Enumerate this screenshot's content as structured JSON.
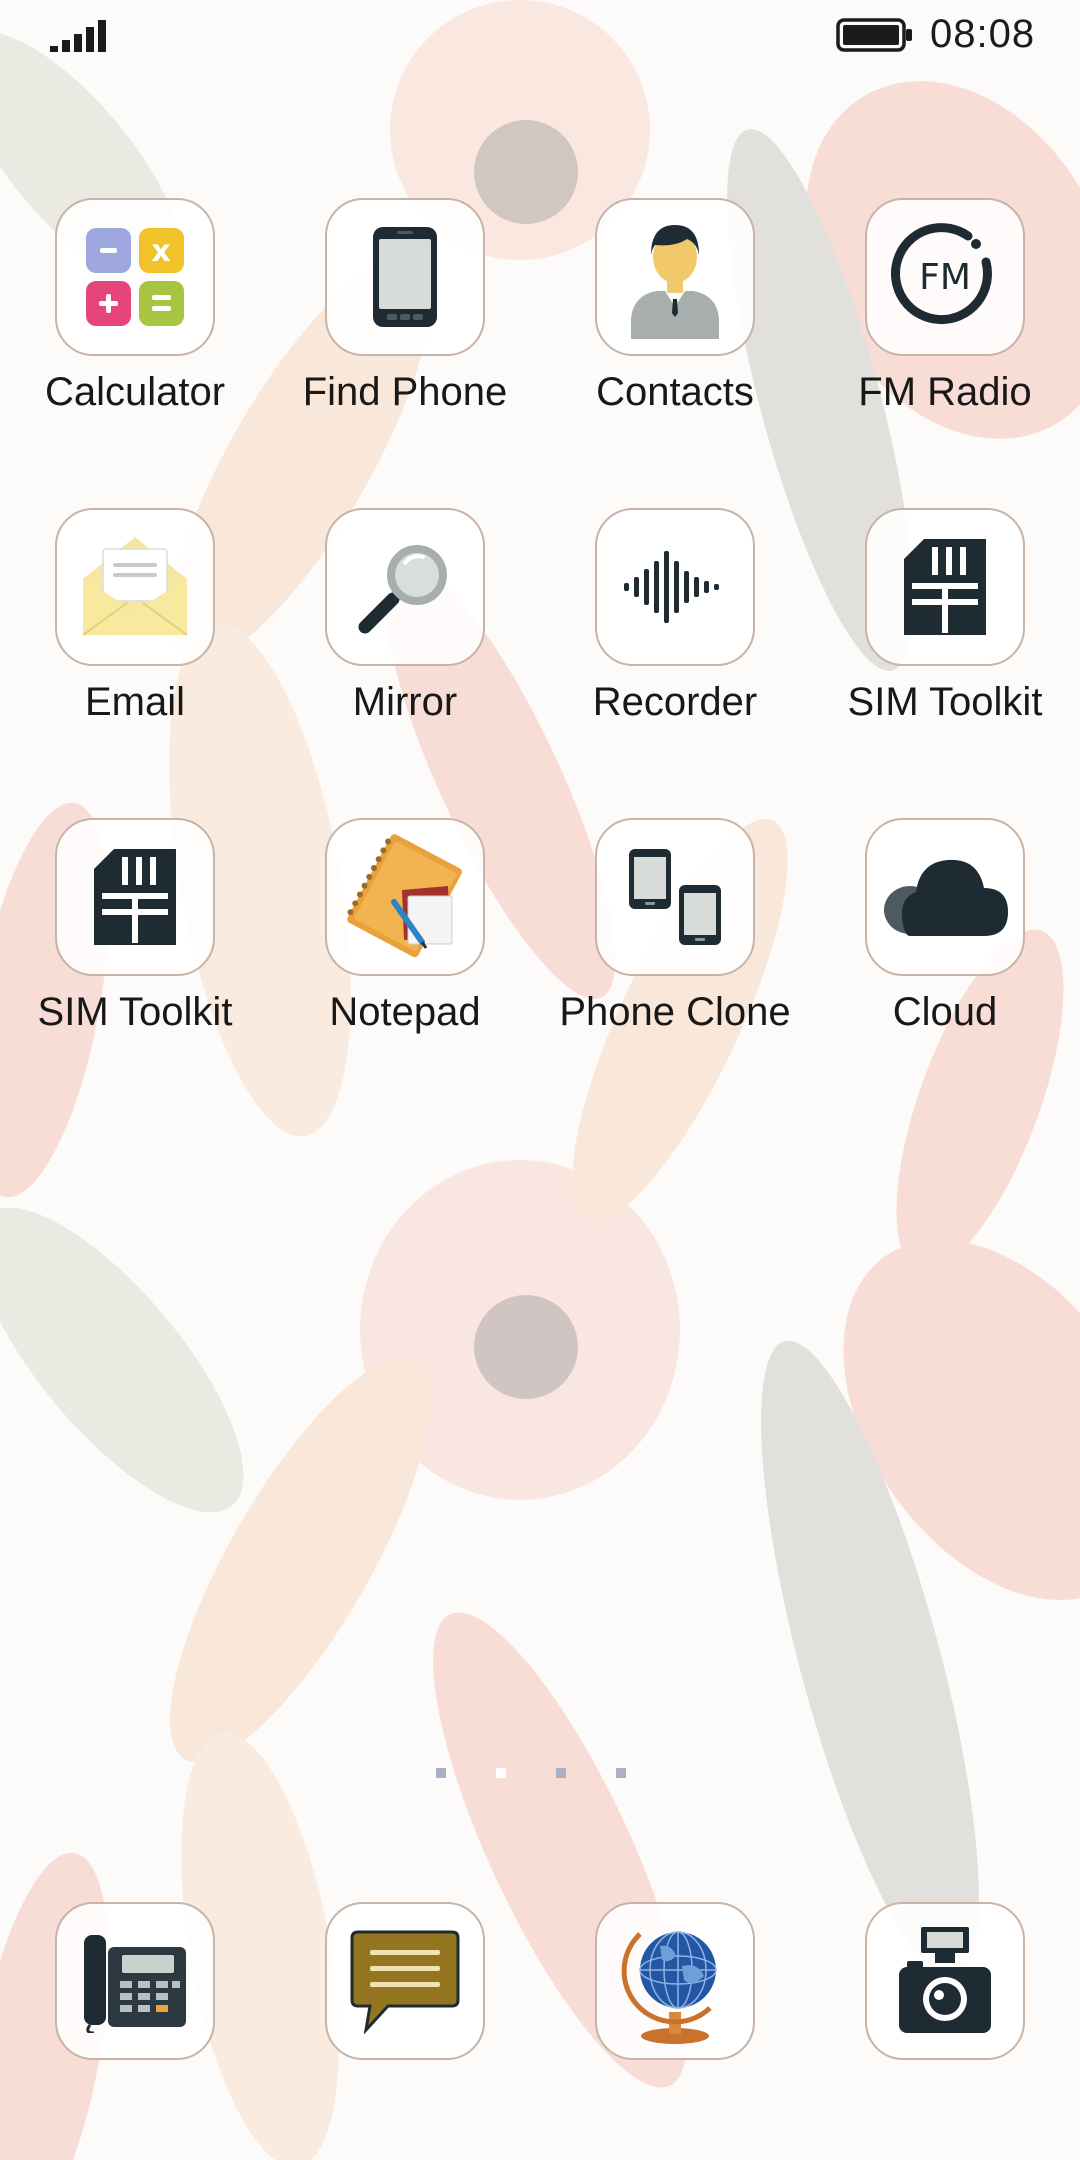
{
  "status_bar": {
    "time": "08:08",
    "signal_icon": "signal-bars-icon",
    "battery_icon": "battery-full-icon"
  },
  "apps": [
    {
      "label": "Calculator",
      "icon": "calculator-icon"
    },
    {
      "label": "Find Phone",
      "icon": "phone-icon"
    },
    {
      "label": "Contacts",
      "icon": "person-icon"
    },
    {
      "label": "FM Radio",
      "icon": "fm-radio-icon"
    },
    {
      "label": "Email",
      "icon": "envelope-icon"
    },
    {
      "label": "Mirror",
      "icon": "magnifier-icon"
    },
    {
      "label": "Recorder",
      "icon": "waveform-icon"
    },
    {
      "label": "SIM Toolkit",
      "icon": "sim-card-icon"
    },
    {
      "label": "SIM Toolkit",
      "icon": "sim-card-icon"
    },
    {
      "label": "Notepad",
      "icon": "notepad-icon"
    },
    {
      "label": "Phone Clone",
      "icon": "two-phones-icon"
    },
    {
      "label": "Cloud",
      "icon": "cloud-icon"
    }
  ],
  "page_indicator": {
    "count": 4,
    "current": 2
  },
  "dock": [
    {
      "name": "Phone",
      "icon": "desk-phone-icon"
    },
    {
      "name": "Messages",
      "icon": "message-bubble-icon"
    },
    {
      "name": "Browser",
      "icon": "globe-icon"
    },
    {
      "name": "Camera",
      "icon": "camera-icon"
    }
  ],
  "colors": {
    "icon_dark": "#1f2b33",
    "icon_border": "#c7b4a6",
    "label_text": "#181818"
  }
}
